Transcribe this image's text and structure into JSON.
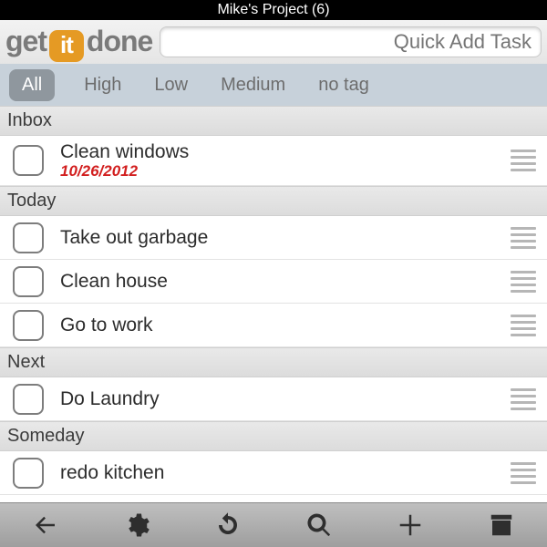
{
  "statusbar": {
    "title": "Mike's Project (6)"
  },
  "logo": {
    "p1": "get",
    "p2": "it",
    "p3": "done"
  },
  "quickadd": {
    "placeholder": "Quick Add Task"
  },
  "filters": [
    "All",
    "High",
    "Low",
    "Medium",
    "no tag"
  ],
  "active_filter_index": 0,
  "sections": [
    {
      "title": "Inbox",
      "tasks": [
        {
          "title": "Clean windows",
          "date": "10/26/2012"
        }
      ]
    },
    {
      "title": "Today",
      "tasks": [
        {
          "title": "Take out garbage"
        },
        {
          "title": "Clean house"
        },
        {
          "title": "Go to work"
        }
      ]
    },
    {
      "title": "Next",
      "tasks": [
        {
          "title": "Do Laundry"
        }
      ]
    },
    {
      "title": "Someday",
      "tasks": [
        {
          "title": "redo kitchen"
        }
      ]
    }
  ],
  "toolbar": {
    "back": "back-icon",
    "settings": "gear-icon",
    "refresh": "refresh-icon",
    "search": "search-icon",
    "add": "plus-icon",
    "archive": "archive-icon"
  }
}
